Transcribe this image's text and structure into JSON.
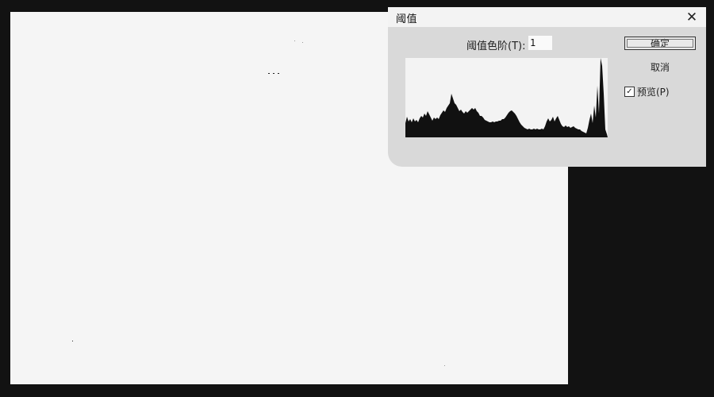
{
  "dialog": {
    "title": "阈值",
    "close_glyph": "✕",
    "threshold_label": "阈值色阶(T):",
    "threshold_value": "1",
    "ok_label": "确定",
    "cancel_label": "取消",
    "preview_label": "预览(P)",
    "preview_checked": true,
    "checkmark_glyph": "✓"
  },
  "colors": {
    "canvas_bg": "#f5f5f5",
    "dialog_bg": "#d9d9d9",
    "workspace_bg": "#121212",
    "histogram_fill": "#111111"
  }
}
